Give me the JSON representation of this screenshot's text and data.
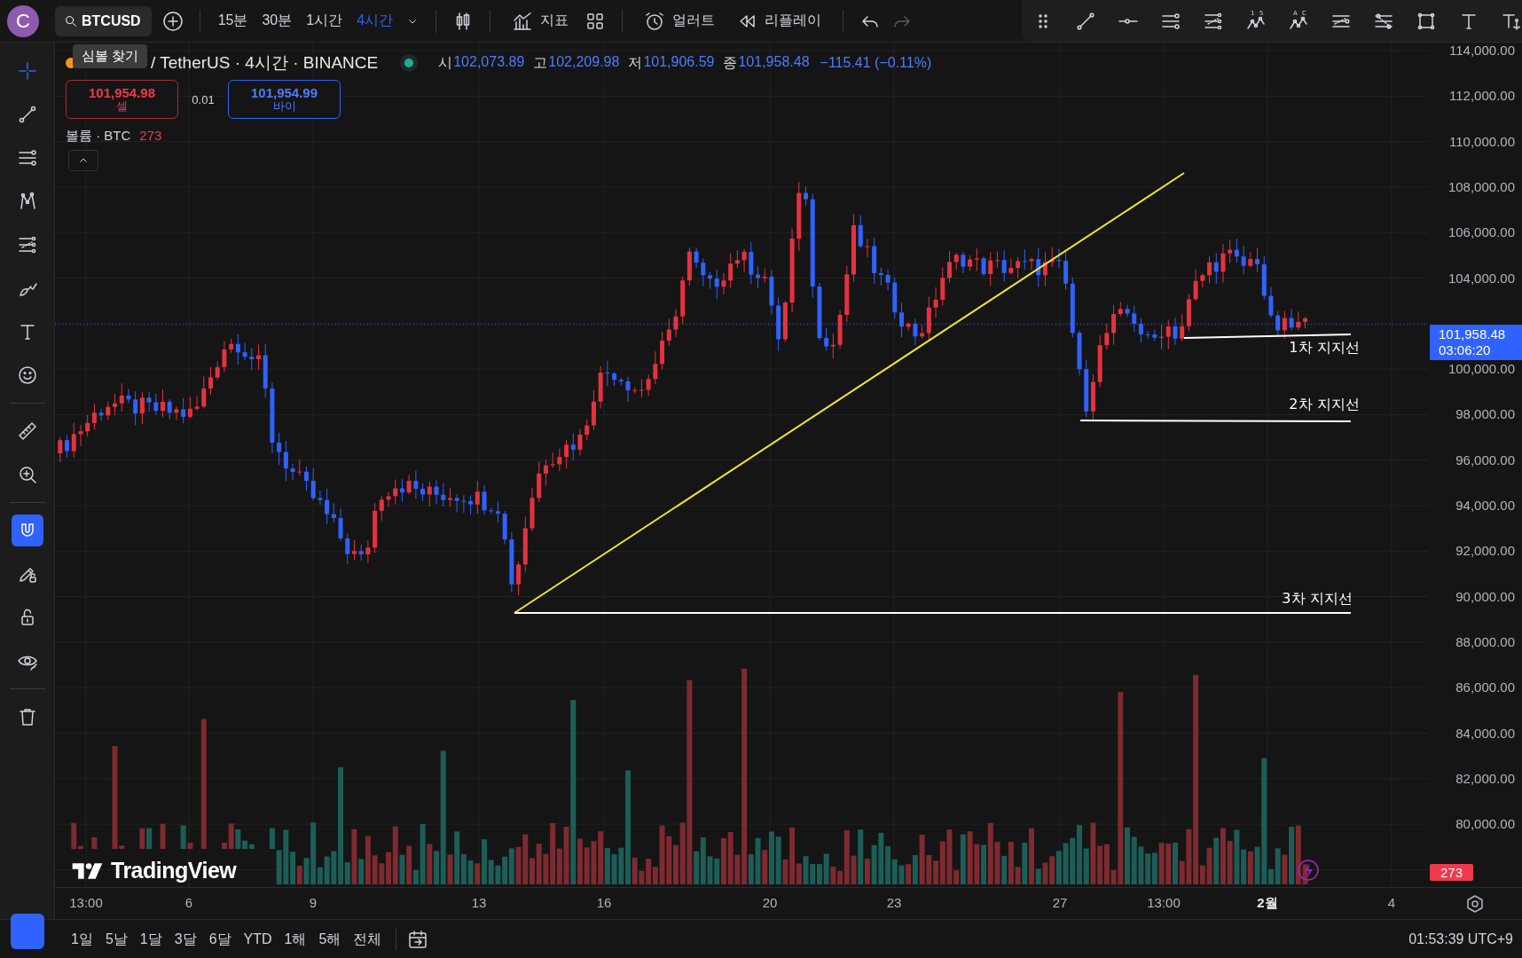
{
  "account": {
    "initial": "C"
  },
  "symbol_search": {
    "label": "BTCUSD"
  },
  "intervals": [
    {
      "label": "15분",
      "selected": false
    },
    {
      "label": "30분",
      "selected": false
    },
    {
      "label": "1시간",
      "selected": false
    },
    {
      "label": "4시간",
      "selected": true
    }
  ],
  "toolbar": [
    {
      "kind": "indicators",
      "label": "지표"
    },
    {
      "kind": "alert",
      "label": "얼러트"
    },
    {
      "kind": "replay",
      "label": "리플레이"
    }
  ],
  "history": [
    {
      "kind": "undo",
      "disabled": false
    },
    {
      "kind": "redo",
      "disabled": true
    }
  ],
  "drawing_toolbar": [
    {
      "kind": "grip"
    },
    {
      "kind": "line"
    },
    {
      "kind": "hray"
    },
    {
      "kind": "hlines"
    },
    {
      "kind": "fib"
    },
    {
      "kind": "wave",
      "marks": [
        "1",
        "5"
      ]
    },
    {
      "kind": "wave",
      "marks": [
        "A",
        "C"
      ]
    },
    {
      "kind": "list"
    },
    {
      "kind": "list2"
    },
    {
      "kind": "rect"
    },
    {
      "kind": "text"
    },
    {
      "kind": "anchored-text"
    }
  ],
  "tooltip": {
    "text": "심볼 찾기"
  },
  "legend": {
    "title": "/ TetherUS · 4시간 · BINANCE",
    "market_open": true,
    "ohlc": [
      {
        "label": "시",
        "value": "102,073.89"
      },
      {
        "label": "고",
        "value": "102,209.98"
      },
      {
        "label": "저",
        "value": "101,906.59"
      },
      {
        "label": "종",
        "value": "101,958.48"
      }
    ],
    "change": "−115.41 (−0.11%)"
  },
  "trade": {
    "sell_price": "101,954.98",
    "sell_label": "셀",
    "quantity": "0.01",
    "buy_price": "101,954.99",
    "buy_label": "바이"
  },
  "volume_legend": {
    "label": "볼륨 · BTC",
    "value": "273"
  },
  "left_tools": [
    {
      "kind": "crosshair",
      "selected": true
    },
    {
      "kind": "trendline",
      "selected": false
    },
    {
      "kind": "hlines",
      "selected": false
    },
    {
      "kind": "pattern",
      "selected": false
    },
    {
      "kind": "fib",
      "selected": false
    },
    {
      "kind": "brush",
      "selected": false
    },
    {
      "kind": "text",
      "selected": false
    },
    {
      "kind": "smile",
      "selected": false
    },
    {
      "kind": "ruler",
      "selected": false
    },
    {
      "kind": "zoom",
      "selected": false
    },
    {
      "kind": "magnet",
      "on": true
    },
    {
      "kind": "draw-lock",
      "on": false
    },
    {
      "kind": "lock",
      "on": false
    },
    {
      "kind": "hide",
      "on": false
    },
    {
      "kind": "trash"
    }
  ],
  "annotations": [
    {
      "label": "1차 지지선"
    },
    {
      "label": "2차 지지선"
    },
    {
      "label": "3차 지지선"
    }
  ],
  "branding": {
    "text": "TradingView"
  },
  "price_axis": {
    "labels": [
      "114,000.00",
      "112,000.00",
      "110,000.00",
      "108,000.00",
      "106,000.00",
      "104,000.00",
      "100,000.00",
      "98,000.00",
      "96,000.00",
      "94,000.00",
      "92,000.00",
      "90,000.00",
      "88,000.00",
      "86,000.00",
      "84,000.00",
      "82,000.00",
      "80,000.00"
    ],
    "last_price": "101,958.48",
    "countdown": "03:06:20",
    "volume_badge": "273"
  },
  "time_axis": {
    "labels": [
      {
        "text": "13:00",
        "emphasized": false
      },
      {
        "text": "6",
        "emphasized": false
      },
      {
        "text": "9",
        "emphasized": false
      },
      {
        "text": "13",
        "emphasized": false
      },
      {
        "text": "16",
        "emphasized": false
      },
      {
        "text": "20",
        "emphasized": false
      },
      {
        "text": "23",
        "emphasized": false
      },
      {
        "text": "27",
        "emphasized": false
      },
      {
        "text": "13:00",
        "emphasized": false
      },
      {
        "text": "2월",
        "emphasized": true
      },
      {
        "text": "4",
        "emphasized": false
      }
    ]
  },
  "ranges": [
    "1일",
    "5날",
    "1달",
    "3달",
    "6달",
    "YTD",
    "1해",
    "5해",
    "전체"
  ],
  "clock": "01:53:39 UTC+9"
}
